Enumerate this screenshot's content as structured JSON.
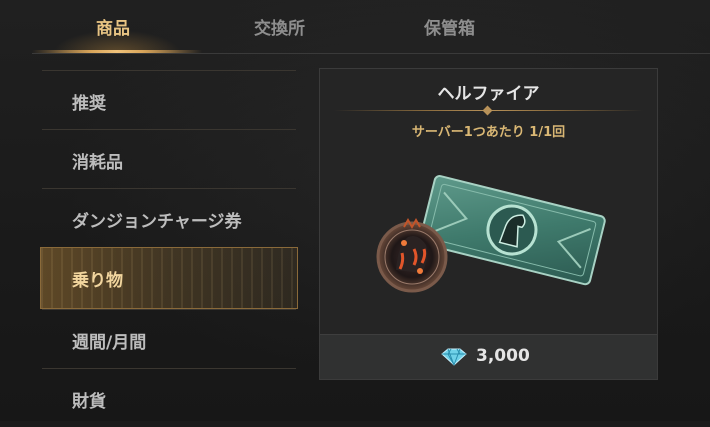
{
  "tabs": [
    {
      "label": "商品",
      "active": true
    },
    {
      "label": "交換所",
      "active": false
    },
    {
      "label": "保管箱",
      "active": false
    }
  ],
  "sidebar": {
    "items": [
      {
        "label": "推奨",
        "active": false
      },
      {
        "label": "消耗品",
        "active": false
      },
      {
        "label": "ダンジョンチャージ券",
        "active": false
      },
      {
        "label": "乗り物",
        "active": true
      },
      {
        "label": "週間/月間",
        "active": false
      },
      {
        "label": "財貨",
        "active": false
      }
    ]
  },
  "product": {
    "title": "ヘルファイア",
    "limit": "サーバー1つあたり 1/1回",
    "price": "3,000",
    "currency_icon": "diamond-icon"
  },
  "colors": {
    "accent": "#e8c483",
    "active_bg": "#8a6a3a",
    "card_bg": "#252525"
  }
}
